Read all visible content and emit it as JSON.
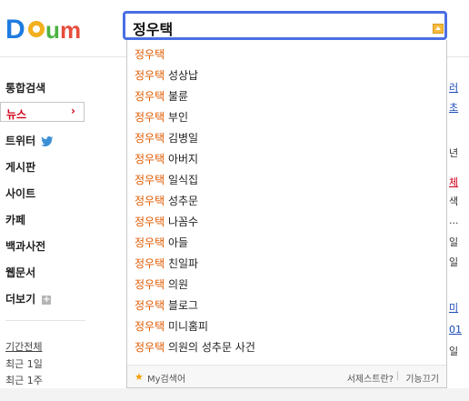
{
  "logo": {
    "text": "Daum"
  },
  "search": {
    "query": "정우택",
    "dropdown_icon": "chevron-up-icon"
  },
  "sidebar": {
    "items": [
      {
        "label": "통합검색"
      },
      {
        "label": "뉴스",
        "arrow": "›"
      },
      {
        "label": "트위터"
      },
      {
        "label": "게시판"
      },
      {
        "label": "사이트"
      },
      {
        "label": "카페"
      },
      {
        "label": "백과사전"
      },
      {
        "label": "웹문서"
      },
      {
        "label": "더보기",
        "plus": "+"
      }
    ],
    "period_label": "기간전체",
    "period_items": [
      "최근 1일",
      "최근 1주"
    ]
  },
  "suggestions": {
    "highlight": "정우택",
    "items": [
      {
        "suffix": ""
      },
      {
        "suffix": " 성상납"
      },
      {
        "suffix": " 불륜"
      },
      {
        "suffix": " 부인"
      },
      {
        "suffix": " 김병일"
      },
      {
        "suffix": " 아버지"
      },
      {
        "suffix": " 일식집"
      },
      {
        "suffix": " 성추문"
      },
      {
        "suffix": " 나꼼수"
      },
      {
        "suffix": " 아들"
      },
      {
        "suffix": " 친일파"
      },
      {
        "suffix": " 의원"
      },
      {
        "suffix": " 블로그"
      },
      {
        "suffix": " 미니홈피"
      },
      {
        "suffix": " 의원의 성추문 사건"
      }
    ],
    "footer": {
      "my_label": "My검색어",
      "helper_label": "서제스트란?",
      "close_label": "기능끄기"
    }
  },
  "right_fragments": [
    "러",
    "초",
    "년",
    "체",
    "색",
    "...",
    "일",
    "일",
    "미",
    "01",
    "일"
  ]
}
